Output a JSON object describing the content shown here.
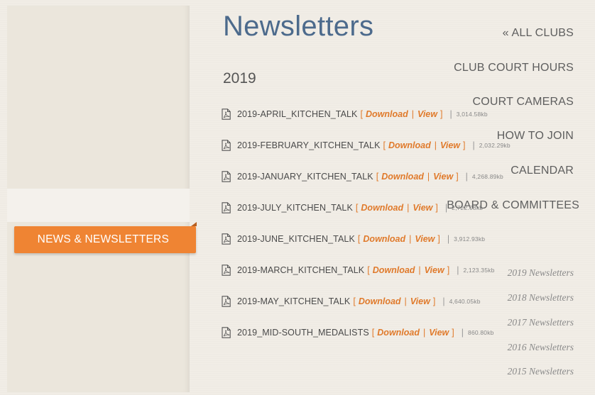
{
  "sidebar": {
    "items": [
      {
        "label": "« ALL CLUBS"
      },
      {
        "label": "CLUB COURT HOURS"
      },
      {
        "label": "COURT CAMERAS"
      },
      {
        "label": "HOW TO JOIN"
      },
      {
        "label": "CALENDAR"
      },
      {
        "label": "BOARD & COMMITTEES"
      },
      {
        "label": "NEWS & NEWSLETTERS"
      }
    ],
    "subitems": [
      {
        "label": "2019 Newsletters"
      },
      {
        "label": "2018 Newsletters"
      },
      {
        "label": "2017 Newsletters"
      },
      {
        "label": "2016 Newsletters"
      },
      {
        "label": "2015 Newsletters"
      }
    ]
  },
  "main": {
    "title": "Newsletters",
    "year": "2019",
    "download_label": "Download",
    "view_label": "View",
    "files": [
      {
        "name": "2019-APRIL_KITCHEN_TALK",
        "size": "3,014.58kb"
      },
      {
        "name": "2019-FEBRUARY_KITCHEN_TALK",
        "size": "2,032.29kb"
      },
      {
        "name": "2019-JANUARY_KITCHEN_TALK",
        "size": "4,268.89kb"
      },
      {
        "name": "2019-JULY_KITCHEN_TALK",
        "size": "2,722.08kb"
      },
      {
        "name": "2019-JUNE_KITCHEN_TALK",
        "size": "3,912.93kb"
      },
      {
        "name": "2019-MARCH_KITCHEN_TALK",
        "size": "2,123.35kb"
      },
      {
        "name": "2019-MAY_KITCHEN_TALK",
        "size": "4,640.05kb"
      },
      {
        "name": "2019_MID-SOUTH_MEDALISTS",
        "size": "860.80kb"
      }
    ]
  },
  "colors": {
    "accent": "#ef8433",
    "link": "#e07a2b",
    "title": "#4c6a8c"
  },
  "icons": {
    "file": "pdf-file-icon"
  }
}
